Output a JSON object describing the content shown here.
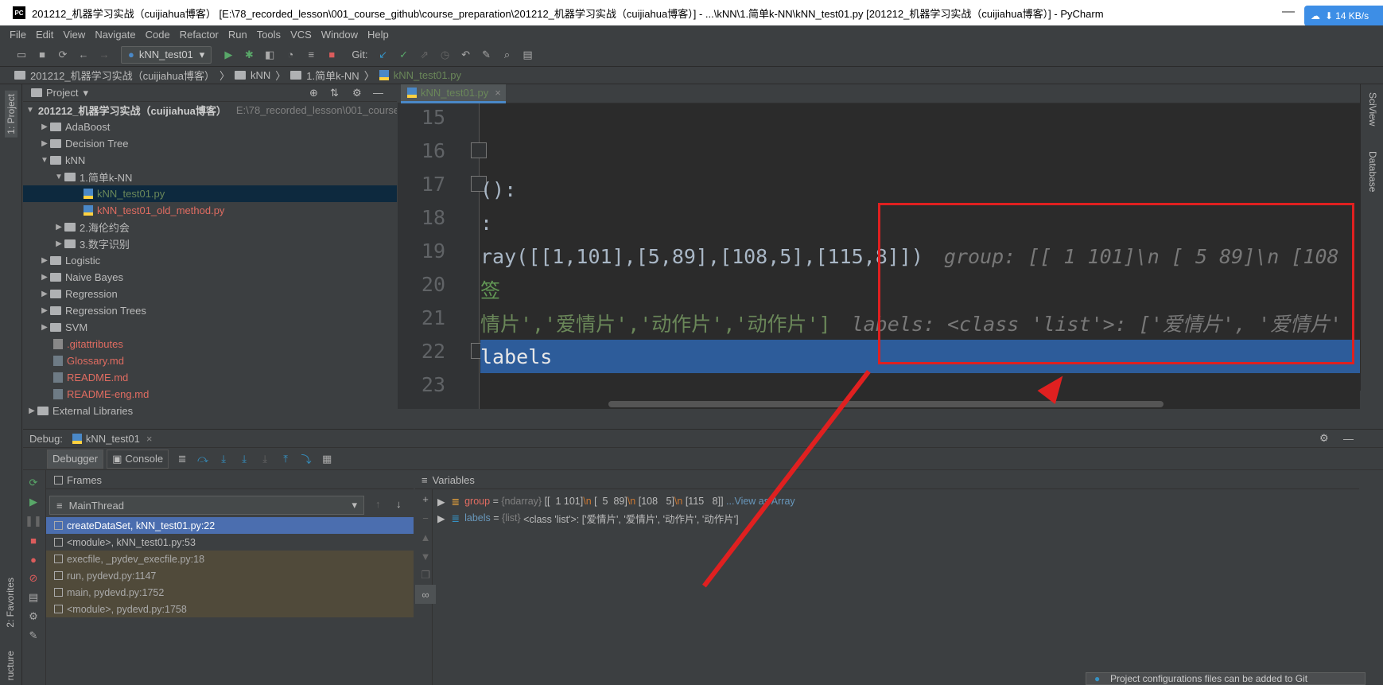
{
  "window": {
    "title": "201212_机器学习实战（cuijiahua博客） [E:\\78_recorded_lesson\\001_course_github\\course_preparation\\201212_机器学习实战（cuijiahua博客）] - ...\\kNN\\1.简单k-NN\\kNN_test01.py [201212_机器学习实战（cuijiahua博客）] - PyCharm",
    "icon": "PC",
    "net_speed": "14 KB/s"
  },
  "menu": [
    "File",
    "Edit",
    "View",
    "Navigate",
    "Code",
    "Refactor",
    "Run",
    "Tools",
    "VCS",
    "Window",
    "Help"
  ],
  "toolbar": {
    "run_config": "kNN_test01",
    "git_label": "Git:"
  },
  "breadcrumb": [
    "201212_机器学习实战（cuijiahua博客）",
    "kNN",
    "1.简单k-NN",
    "kNN_test01.py"
  ],
  "sidebar": {
    "project_tab": "1: Project",
    "favorites_tab": "2: Favorites",
    "structure_tab": "ructure",
    "sciview_tab": "SciView",
    "database_tab": "Database"
  },
  "project": {
    "title": "Project",
    "root": "201212_机器学习实战（cuijiahua博客）",
    "root_path": "E:\\78_recorded_lesson\\001_course",
    "items": [
      {
        "label": "AdaBoost"
      },
      {
        "label": "Decision Tree"
      },
      {
        "label": "kNN"
      },
      {
        "label": "1.简单k-NN"
      },
      {
        "label": "kNN_test01.py"
      },
      {
        "label": "kNN_test01_old_method.py"
      },
      {
        "label": "2.海伦约会"
      },
      {
        "label": "3.数字识别"
      },
      {
        "label": "Logistic"
      },
      {
        "label": "Naive Bayes"
      },
      {
        "label": "Regression"
      },
      {
        "label": "Regression Trees"
      },
      {
        "label": "SVM"
      },
      {
        "label": ".gitattributes"
      },
      {
        "label": "Glossary.md"
      },
      {
        "label": "README.md"
      },
      {
        "label": "README-eng.md"
      },
      {
        "label": "External Libraries"
      }
    ]
  },
  "editor": {
    "tab": "kNN_test01.py",
    "line_numbers": [
      "15",
      "16",
      "17",
      "18",
      "19",
      "20",
      "21",
      "22",
      "23"
    ],
    "lines": [
      {
        "code": ""
      },
      {
        "code": ""
      },
      {
        "code": "():"
      },
      {
        "code": ":"
      },
      {
        "code": "ray([[1,101],[5,89],[108,5],[115,8]])",
        "hint": "group: [[  1 101]\\n [  5  89]\\n [108"
      },
      {
        "code": "签"
      },
      {
        "code": "情片','爱情片','动作片','动作片']",
        "hint": "labels: <class 'list'>: ['爱情片', '爱情片'"
      },
      {
        "code": " labels"
      },
      {
        "code": ""
      }
    ]
  },
  "debug": {
    "label": "Debug:",
    "session": "kNN_test01",
    "debugger_tab": "Debugger",
    "console_tab": "Console",
    "frames_title": "Frames",
    "thread": "MainThread",
    "frames": [
      "createDataSet, kNN_test01.py:22",
      "<module>, kNN_test01.py:53",
      "execfile, _pydev_execfile.py:18",
      "run, pydevd.py:1147",
      "main, pydevd.py:1752",
      "<module>, pydevd.py:1758"
    ],
    "variables_title": "Variables",
    "variables": [
      {
        "name": "group",
        "eq": " = ",
        "type": "{ndarray} ",
        "v1": "[[  1 101]",
        "e1": "\\n",
        "v2": " [  5  89]",
        "e2": "\\n",
        "v3": " [108   5]",
        "e3": "\\n",
        "v4": " [115   8]]",
        "link": " ...View as Array"
      },
      {
        "name": "labels",
        "eq": " = ",
        "type": "{list} ",
        "value": "<class 'list'>: ['爱情片', '爱情片', '动作片', '动作片']"
      }
    ]
  },
  "notification": "Project configurations files can be added to Git"
}
